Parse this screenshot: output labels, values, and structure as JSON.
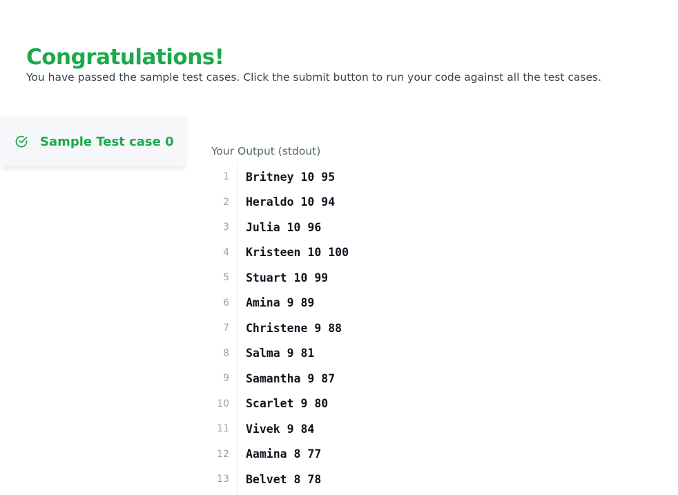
{
  "banner": {
    "title": "Congratulations!",
    "message": "You have passed the sample test cases. Click the submit button to run your code against all the test cases."
  },
  "sidebar": {
    "items": [
      {
        "label": "Sample Test case 0",
        "status": "passed",
        "icon": "check-circle-icon"
      }
    ]
  },
  "output": {
    "title": "Your Output (stdout)",
    "lines": [
      {
        "no": "1",
        "text": "Britney 10 95"
      },
      {
        "no": "2",
        "text": "Heraldo 10 94"
      },
      {
        "no": "3",
        "text": "Julia 10 96"
      },
      {
        "no": "4",
        "text": "Kristeen 10 100"
      },
      {
        "no": "5",
        "text": "Stuart 10 99"
      },
      {
        "no": "6",
        "text": "Amina 9 89"
      },
      {
        "no": "7",
        "text": "Christene 9 88"
      },
      {
        "no": "8",
        "text": "Salma 9 81"
      },
      {
        "no": "9",
        "text": "Samantha 9 87"
      },
      {
        "no": "10",
        "text": "Scarlet 9 80"
      },
      {
        "no": "11",
        "text": "Vivek 9 84"
      },
      {
        "no": "12",
        "text": "Aamina 8 77"
      },
      {
        "no": "13",
        "text": "Belvet 8 78"
      }
    ]
  },
  "colors": {
    "success": "#1ba94c",
    "text": "#39424e",
    "code": "#0e141e",
    "line_number": "#979faf",
    "sidebar_bg": "#f5f7fa"
  }
}
